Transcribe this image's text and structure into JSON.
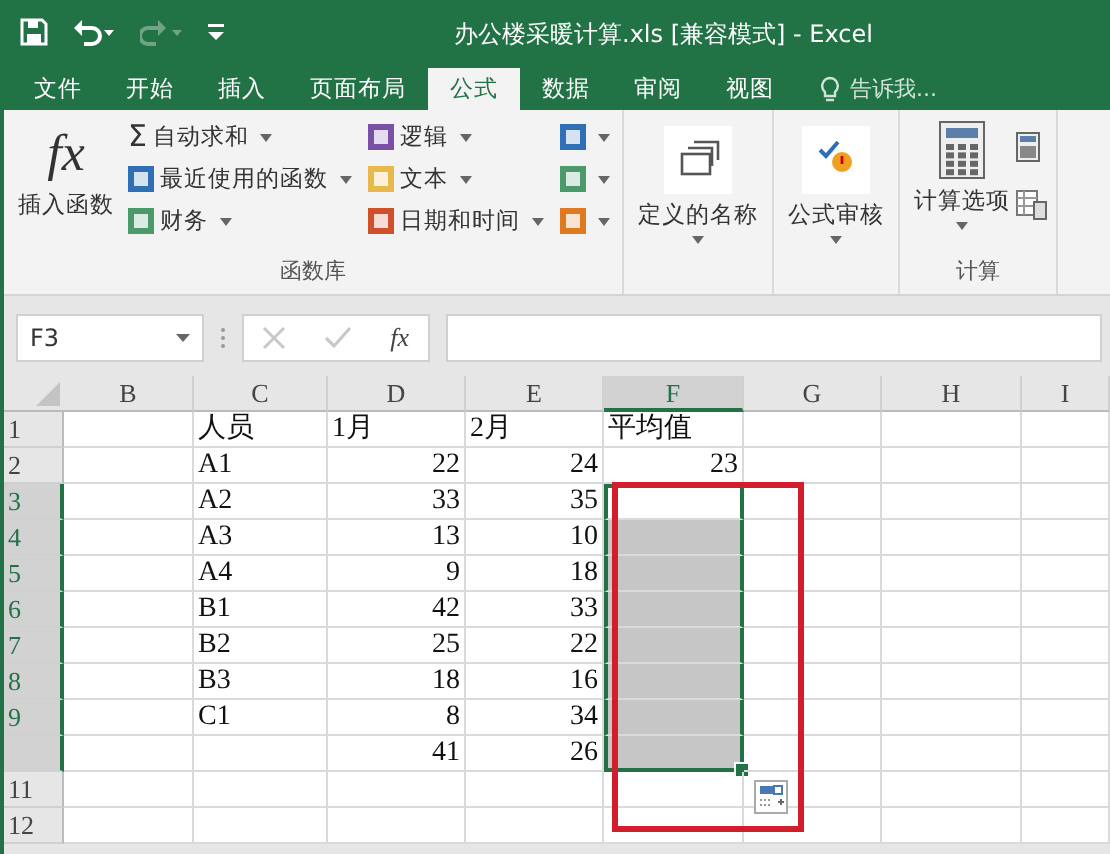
{
  "window": {
    "title": "办公楼采暖计算.xls  [兼容模式] - Excel"
  },
  "quick_access": [
    {
      "kind": "save",
      "disabled": false
    },
    {
      "kind": "undo",
      "disabled": false
    },
    {
      "kind": "redo",
      "disabled": true
    },
    {
      "kind": "customize",
      "disabled": false
    }
  ],
  "tabs": [
    {
      "label": "文件",
      "selected": false
    },
    {
      "label": "开始",
      "selected": false
    },
    {
      "label": "插入",
      "selected": false
    },
    {
      "label": "页面布局",
      "selected": false
    },
    {
      "label": "公式",
      "selected": true
    },
    {
      "label": "数据",
      "selected": false
    },
    {
      "label": "审阅",
      "selected": false
    },
    {
      "label": "视图",
      "selected": false
    }
  ],
  "tell_me": {
    "placeholder": "告诉我..."
  },
  "ribbon": {
    "function_library": {
      "insert_function_icon": "fx",
      "insert_function": "插入函数",
      "sum_icon": "Σ",
      "small_buttons": [
        {
          "kind": "dropdown",
          "label": "自动求和"
        },
        {
          "kind": "dropdown",
          "label": "最近使用的函数"
        },
        {
          "kind": "dropdown",
          "label": "财务"
        },
        {
          "kind": "dropdown",
          "label": "逻辑"
        },
        {
          "kind": "dropdown",
          "label": "文本"
        },
        {
          "kind": "dropdown",
          "label": "日期和时间"
        },
        {
          "kind": "icon"
        },
        {
          "kind": "icon"
        },
        {
          "kind": "icon"
        }
      ],
      "label": "函数库"
    },
    "defined_names": "定义的名称",
    "formula_auditing": "公式审核",
    "calculation": {
      "options": "计算选项",
      "label": "计算"
    }
  },
  "formula_bar": {
    "name_box": "F3",
    "function_icon": "fx"
  },
  "columns": [
    {
      "label": "B",
      "selected": false
    },
    {
      "label": "C",
      "selected": false
    },
    {
      "label": "D",
      "selected": false
    },
    {
      "label": "E",
      "selected": false
    },
    {
      "label": "F",
      "selected": true
    },
    {
      "label": "G",
      "selected": false
    },
    {
      "label": "H",
      "selected": false
    },
    {
      "label": "I",
      "selected": false
    }
  ],
  "rows": [
    {
      "header": "1",
      "selected": false,
      "cells": [
        null,
        {
          "text": "人员"
        },
        {
          "text": "1月"
        },
        {
          "text": "2月"
        },
        {
          "text": "平均值"
        },
        null,
        null,
        null
      ]
    },
    {
      "header": "2",
      "selected": false,
      "cells": [
        null,
        {
          "text": "A1"
        },
        {
          "text": "22",
          "kind": "number"
        },
        {
          "text": "24",
          "kind": "number"
        },
        {
          "text": "23",
          "kind": "number"
        },
        null,
        null,
        null
      ]
    },
    {
      "header": "3",
      "selected": true,
      "cells": [
        null,
        {
          "text": "A2"
        },
        {
          "text": "33",
          "kind": "number"
        },
        {
          "text": "35",
          "kind": "number"
        },
        {
          "selected": true,
          "active": true
        },
        null,
        null,
        null
      ]
    },
    {
      "header": "4",
      "selected": true,
      "cells": [
        null,
        {
          "text": "A3"
        },
        {
          "text": "13",
          "kind": "number"
        },
        {
          "text": "10",
          "kind": "number"
        },
        {
          "selected": true,
          "active": false
        },
        null,
        null,
        null
      ]
    },
    {
      "header": "5",
      "selected": true,
      "cells": [
        null,
        {
          "text": "A4"
        },
        {
          "text": "9",
          "kind": "number"
        },
        {
          "text": "18",
          "kind": "number"
        },
        {
          "selected": true,
          "active": false
        },
        null,
        null,
        null
      ]
    },
    {
      "header": "6",
      "selected": true,
      "cells": [
        null,
        {
          "text": "B1"
        },
        {
          "text": "42",
          "kind": "number"
        },
        {
          "text": "33",
          "kind": "number"
        },
        {
          "selected": true,
          "active": false
        },
        null,
        null,
        null
      ]
    },
    {
      "header": "7",
      "selected": true,
      "cells": [
        null,
        {
          "text": "B2"
        },
        {
          "text": "25",
          "kind": "number"
        },
        {
          "text": "22",
          "kind": "number"
        },
        {
          "selected": true,
          "active": false
        },
        null,
        null,
        null
      ]
    },
    {
      "header": "8",
      "selected": true,
      "cells": [
        null,
        {
          "text": "B3"
        },
        {
          "text": "18",
          "kind": "number"
        },
        {
          "text": "16",
          "kind": "number"
        },
        {
          "selected": true,
          "active": false
        },
        null,
        null,
        null
      ]
    },
    {
      "header": "9",
      "selected": true,
      "cells": [
        null,
        {
          "text": "C1"
        },
        {
          "text": "8",
          "kind": "number"
        },
        {
          "text": "34",
          "kind": "number"
        },
        {
          "selected": true,
          "active": false
        },
        null,
        null,
        null
      ]
    },
    {
      "selected": true,
      "cells": [
        null,
        null,
        {
          "text": "41",
          "kind": "number"
        },
        {
          "text": "26",
          "kind": "number"
        },
        {
          "selected": true,
          "active": false
        },
        null,
        null,
        null
      ]
    },
    {
      "header": "11",
      "selected": false,
      "cells": [
        null,
        null,
        null,
        null,
        null,
        null,
        null,
        null
      ]
    },
    {
      "header": "12",
      "selected": false,
      "cells": [
        null,
        null,
        null,
        null,
        null,
        null,
        null,
        null
      ]
    }
  ]
}
